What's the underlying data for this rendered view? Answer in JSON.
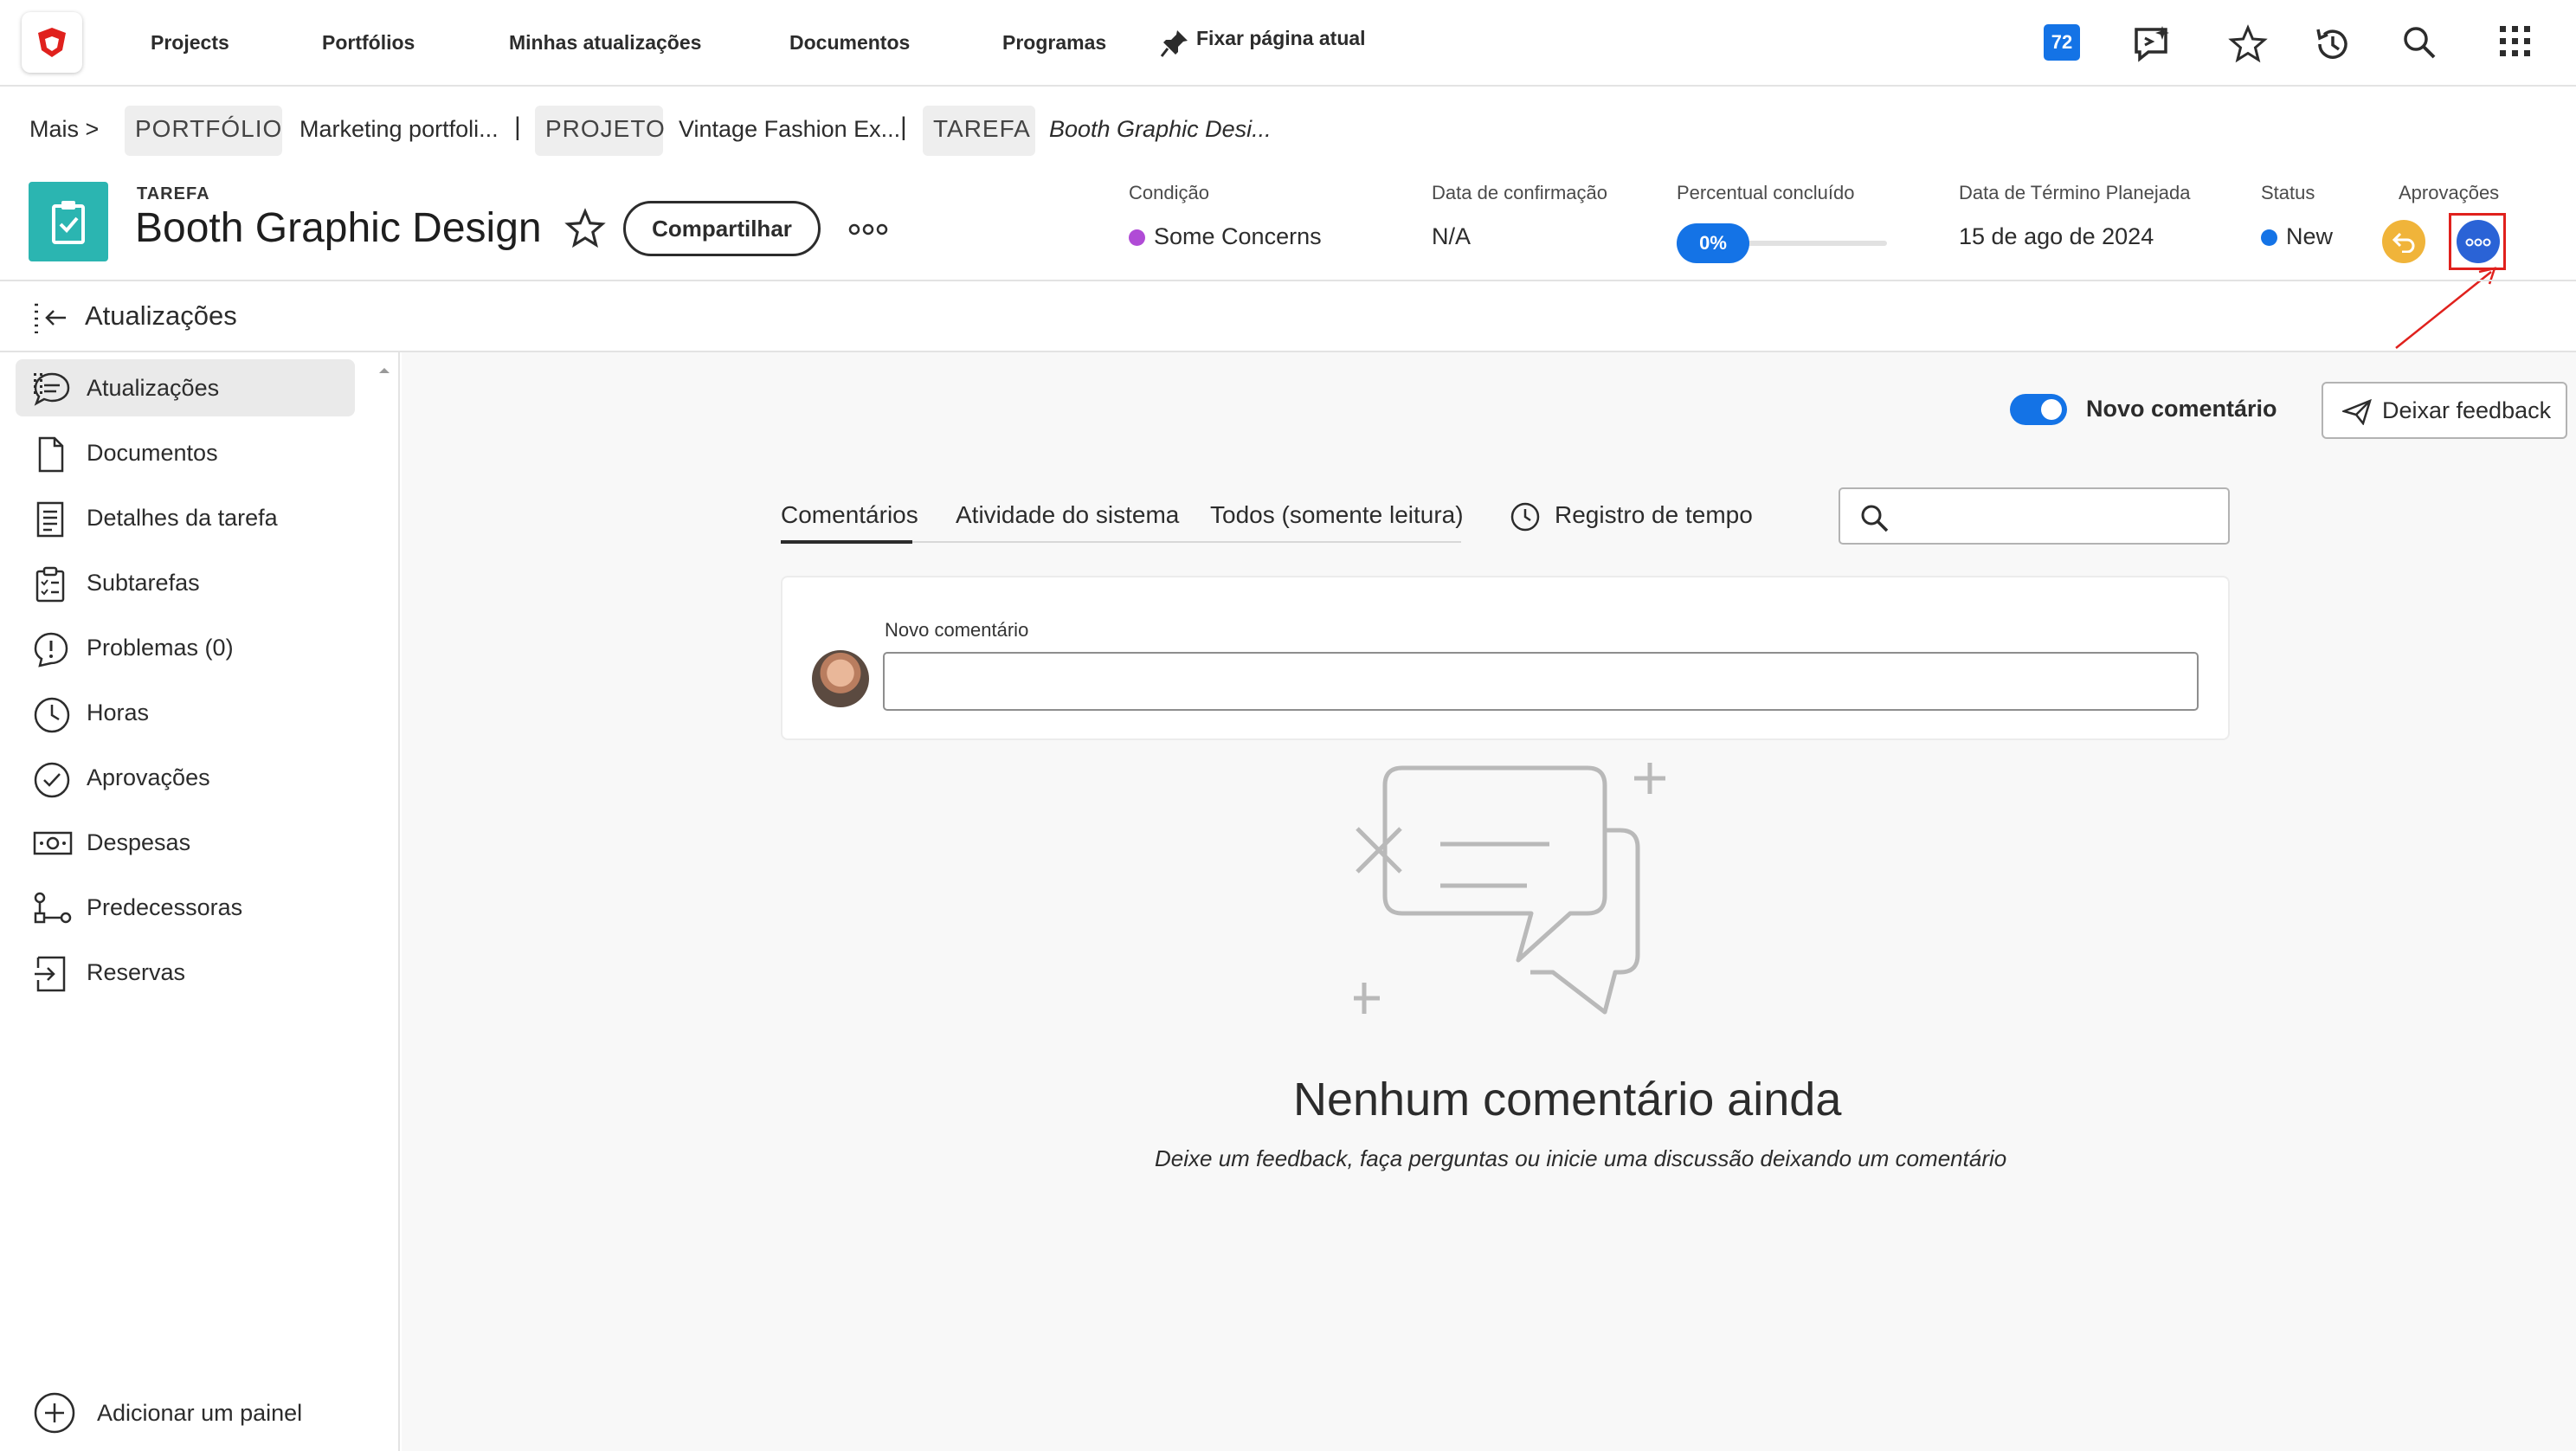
{
  "nav": {
    "items": [
      "Projects",
      "Portfólios",
      "Minhas atualizações",
      "Documentos",
      "Programas"
    ],
    "pin_label": "Fixar página atual",
    "notification_count": "72"
  },
  "breadcrumb": {
    "more": "Mais >",
    "portfolio_type": "PORTFÓLIO",
    "portfolio_name": "Marketing portfoli...",
    "project_type": "PROJETO",
    "project_name": "Vintage Fashion Ex...",
    "task_type": "TAREFA",
    "task_name": "Booth Graphic Desi...",
    "separator": "|"
  },
  "header": {
    "object_type": "TAREFA",
    "title": "Booth Graphic Design",
    "share_label": "Compartilhar",
    "fields": {
      "condition_label": "Condição",
      "condition_value": "Some Concerns",
      "condition_color": "#b04bd6",
      "commit_label": "Data de confirmação",
      "commit_value": "N/A",
      "percent_label": "Percentual concluído",
      "percent_value": "0%",
      "percent_fraction": 0,
      "planned_label": "Data de Término Planejada",
      "planned_value": "15 de ago de 2024",
      "status_label": "Status",
      "status_value": "New",
      "status_color": "#1473e6",
      "approvals_label": "Aprovações"
    }
  },
  "subheader": {
    "title": "Atualizações"
  },
  "sidebar": {
    "items": [
      {
        "label": "Atualizações",
        "icon": "chat-bubble-icon"
      },
      {
        "label": "Documentos",
        "icon": "document-icon"
      },
      {
        "label": "Detalhes da tarefa",
        "icon": "details-icon"
      },
      {
        "label": "Subtarefas",
        "icon": "checklist-icon"
      },
      {
        "label": "Problemas (0)",
        "icon": "issue-icon"
      },
      {
        "label": "Horas",
        "icon": "clock-icon"
      },
      {
        "label": "Aprovações",
        "icon": "check-circle-icon"
      },
      {
        "label": "Despesas",
        "icon": "money-icon"
      },
      {
        "label": "Predecessoras",
        "icon": "flow-icon"
      },
      {
        "label": "Reservas",
        "icon": "booking-icon"
      }
    ],
    "add_panel_label": "Adicionar um painel"
  },
  "main": {
    "toggle_label": "Novo comentário",
    "feedback_label": "Deixar feedback",
    "tabs": [
      "Comentários",
      "Atividade do sistema",
      "Todos (somente leitura)"
    ],
    "time_tab_label": "Registro de tempo",
    "comment_label": "Novo comentário",
    "empty_title": "Nenhum comentário ainda",
    "empty_subtitle": "Deixe um feedback, faça perguntas ou inicie uma discussão deixando um comentário"
  },
  "colors": {
    "accent": "#1473e6",
    "task_icon": "#2bb5b1",
    "approval_undo": "#f0b43a",
    "annotation_red": "#e0211d"
  }
}
